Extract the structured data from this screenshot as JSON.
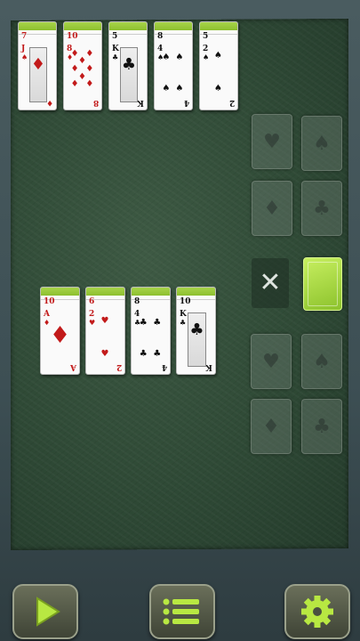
{
  "top_tableau": [
    {
      "top": "7",
      "mid": "J",
      "mid_suit": "♠",
      "face_suit": "♦",
      "bottom": "♦",
      "kind": "face",
      "color": "red"
    },
    {
      "top": "10",
      "mid": "8",
      "mid_suit": "♦",
      "face_suit": "♦",
      "bottom": "8",
      "kind": "pips",
      "color": "red"
    },
    {
      "top": "5",
      "mid": "K",
      "mid_suit": "♣",
      "face_suit": "♣",
      "bottom": "K",
      "kind": "face",
      "color": "blk"
    },
    {
      "top": "8",
      "mid": "4",
      "mid_suit": "♠",
      "face_suit": "♠",
      "bottom": "4",
      "kind": "pips",
      "color": "blk"
    },
    {
      "top": "5",
      "mid": "2",
      "mid_suit": "♠",
      "face_suit": "♠",
      "bottom": "2",
      "kind": "pips",
      "color": "blk"
    }
  ],
  "bottom_tableau": [
    {
      "top": "10",
      "mid": "A",
      "mid_suit": "♦",
      "face_suit": "♦",
      "bottom": "A",
      "kind": "ace",
      "color": "red"
    },
    {
      "top": "6",
      "mid": "2",
      "mid_suit": "♥",
      "face_suit": "♥",
      "bottom": "2",
      "kind": "pips",
      "color": "red"
    },
    {
      "top": "8",
      "mid": "4",
      "mid_suit": "♣",
      "face_suit": "♣",
      "bottom": "4",
      "kind": "pips",
      "color": "blk"
    },
    {
      "top": "10",
      "mid": "K",
      "mid_suit": "♣",
      "face_suit": "♣",
      "bottom": "K",
      "kind": "face",
      "color": "blk"
    }
  ],
  "foundations_top": [
    "♥",
    "♠",
    "♦",
    "♣"
  ],
  "foundations_bottom": [
    "♥",
    "♠",
    "♦",
    "♣"
  ],
  "discard_label": "✕",
  "toolbar": {
    "play": "play-icon",
    "menu": "menu-icon",
    "settings": "gear-icon"
  },
  "colors": {
    "accent": "#9acb36",
    "felt": "#2f4a36"
  }
}
